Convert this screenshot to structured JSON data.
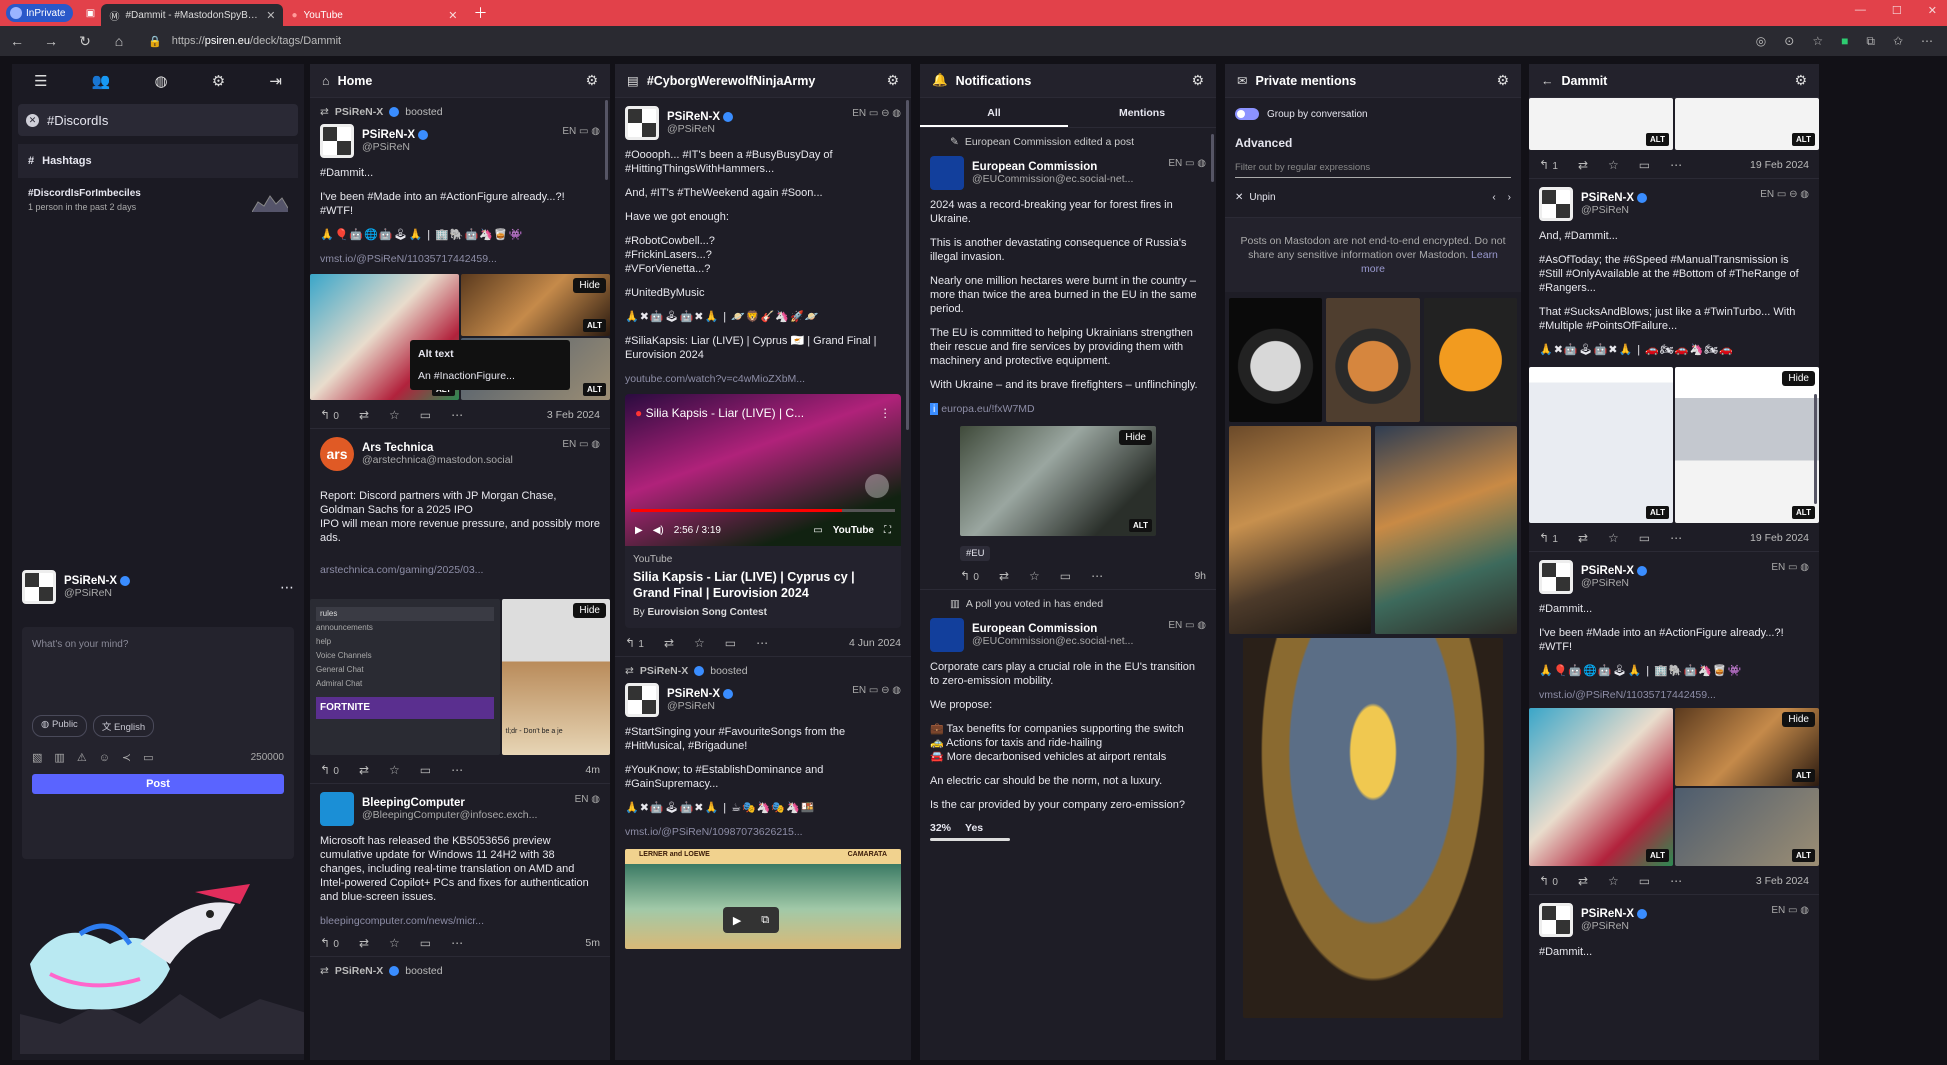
{
  "browser": {
    "inprivate": "InPrivate",
    "tabs": [
      {
        "title": "#Dammit - #MastodonSpyBalloon",
        "active": true
      },
      {
        "title": "YouTube",
        "active": false
      }
    ],
    "url_scheme": "https://",
    "url_host": "psiren.eu",
    "url_path": "/deck/tags/Dammit"
  },
  "nav": {
    "search_tag": "#DiscordIs",
    "hashtags_label": "Hashtags",
    "trend_tag": "#DiscordIsForImbeciles",
    "trend_stat": "1 person in the past 2 days",
    "me_name": "PSiReN-X",
    "me_acct": "@PSiReN",
    "compose_placeholder": "What's on your mind?",
    "visibility": "Public",
    "language": "English",
    "char_count": "250000",
    "post_label": "Post"
  },
  "home": {
    "title": "Home",
    "p1": {
      "boosted_by": "PSiReN-X",
      "boosted_label": "boosted",
      "name": "PSiReN-X",
      "acct": "@PSiReN",
      "lang": "EN",
      "l1": "#Dammit...",
      "l2": "I've been #Made into an #ActionFigure already...?! #WTF!",
      "emoji": "🙏🎈🤖🌐🤖🕹🙏 | 🏢🐘🤖🦄🥃👾",
      "link": "vmst.io/@PSiReN/11035717442459...",
      "alt_title": "Alt text",
      "alt_body": "An #InactionFigure...",
      "hide": "Hide",
      "alt": "ALT",
      "reply": "0",
      "date": "3 Feb 2024"
    },
    "p2": {
      "name": "Ars Technica",
      "acct": "@arstechnica@mastodon.social",
      "lang": "EN",
      "body": "Report: Discord partners with JP Morgan Chase, Goldman Sachs for a 2025 IPO\nIPO will mean more revenue pressure, and possibly more ads.",
      "link": "arstechnica.com/gaming/2025/03...",
      "reply": "0",
      "date": "4m",
      "shot_lines": [
        "rules",
        "announcements",
        "help",
        "Voice Channels",
        "General Chat",
        "Admiral Chat"
      ],
      "shot_banner": "FORTNITE",
      "shot_hint": "tl;dr - Don't be a je",
      "hide": "Hide"
    },
    "p3": {
      "name": "BleepingComputer",
      "acct": "@BleepingComputer@infosec.exch...",
      "lang": "EN",
      "body": "Microsoft has released the KB5053656 preview cumulative update for Windows 11 24H2 with 38 changes, including real-time translation on AMD and Intel-powered Copilot+ PCs and fixes for authentication and blue-screen issues.",
      "link": "bleepingcomputer.com/news/micr...",
      "reply": "0",
      "date": "5m"
    },
    "p4_boost": "PSiReN-X",
    "p4_boost_label": "boosted"
  },
  "cyborg": {
    "title": "#CyborgWerewolfNinjaArmy",
    "p1": {
      "name": "PSiReN-X",
      "acct": "@PSiReN",
      "lang": "EN",
      "b1": "#Ooooph... #IT's been a #BusyBusyDay of #HittingThingsWithHammers...",
      "b2": "And, #IT's #TheWeekend again #Soon...",
      "b3": "Have we got enough:",
      "b4": "#RobotCowbell...?\n#FrickinLasers...?\n#VForVienetta...?",
      "b5": "#UnitedByMusic",
      "emoji": "🙏✖🤖🕹🤖✖🙏 | 🪐🦁🎸🦄🚀🪐",
      "b6": "#SiliaKapsis: Liar (LIVE) | Cyprus 🇨🇾 | Grand Final | Eurovision 2024",
      "link": "youtube.com/watch?v=c4wMioZXbM...",
      "yt_title": "Silia Kapsis - Liar (LIVE) | C...",
      "yt_time": "2:56 / 3:19",
      "yt_brand": "YouTube",
      "yt_src": "YouTube",
      "yt_card_title": "Silia Kapsis - Liar (LIVE) | Cyprus cy | Grand Final | Eurovision 2024",
      "yt_by_label": "By",
      "yt_by": "Eurovision Song Contest",
      "reply": "1",
      "date": "4 Jun 2024"
    },
    "p2": {
      "boosted_by": "PSiReN-X",
      "boosted_label": "boosted",
      "name": "PSiReN-X",
      "acct": "@PSiReN",
      "lang": "EN",
      "b1": "#StartSinging your #FavouriteSongs from the #HitMusical, #Brigadune!",
      "b2": "#YouKnow; to #EstablishDominance and #GainSupremacy...",
      "emoji": "🙏✖🤖🕹🤖✖🙏 | ☕🎭🦄🎭🦄🍱",
      "link": "vmst.io/@PSiReN/10987073626215...",
      "poster_left": "LERNER and LOEWE",
      "poster_right": "CAMARATA"
    }
  },
  "notifications": {
    "title": "Notifications",
    "tab_all": "All",
    "tab_mentions": "Mentions",
    "n1_head": "European Commission edited a post",
    "n1": {
      "name": "European Commission",
      "acct": "@EUCommission@ec.social-net...",
      "lang": "EN",
      "b1": "2024 was a record-breaking year for forest fires in Ukraine.",
      "b2": "This is another devastating consequence of Russia's illegal invasion.",
      "b3": "Nearly one million hectares were burnt in the country – more than twice the area burned in the EU in the same period.",
      "b4": "The EU is committed to helping Ukrainians strengthen their rescue and fire services by providing them with machinery and protective equipment.",
      "b5": "With Ukraine – and its brave firefighters – unflinchingly.",
      "link": "europa.eu/!fxW7MD",
      "tag": "#EU",
      "hide": "Hide",
      "alt": "ALT",
      "reply": "0",
      "date": "9h"
    },
    "n2_head": "A poll you voted in has ended",
    "n2": {
      "name": "European Commission",
      "acct": "@EUCommission@ec.social-net...",
      "lang": "EN",
      "b1": "Corporate cars play a crucial role in the EU's transition to zero-emission mobility.",
      "b2": "We propose:",
      "b3": "💼 Tax benefits for companies supporting the switch\n🚕 Actions for taxis and ride-hailing\n🚘 More decarbonised vehicles at airport rentals",
      "b4": "An electric car should be the norm, not a luxury.",
      "b5": "Is the car provided by your company zero-emission?",
      "poll_pct": "32%",
      "poll_opt": "Yes",
      "poll_fraction": 0.32
    }
  },
  "mentions": {
    "title": "Private mentions",
    "group_label": "Group by conversation",
    "advanced": "Advanced",
    "filter_placeholder": "Filter out by regular expressions",
    "unpin": "Unpin",
    "e2e_text": "Posts on Mastodon are not end-to-end encrypted. Do not share any sensitive information over Mastodon.",
    "learn_more": "Learn more"
  },
  "dammit": {
    "title": "Dammit",
    "p0": {
      "reply": "1",
      "date": "19 Feb 2024",
      "alt": "ALT"
    },
    "p1": {
      "name": "PSiReN-X",
      "acct": "@PSiReN",
      "lang": "EN",
      "b1": "And, #Dammit...",
      "b2": "#AsOfToday; the #6Speed #ManualTransmission is #Still #OnlyAvailable at the #Bottom of #TheRange of #Rangers...",
      "b3": "That #SucksAndBlows; just like a #TwinTurbo... With #Multiple #PointsOfFailure...",
      "emoji": "🙏✖🤖🕹🤖✖🙏 | 🚗🏍🚗🦄🏍🚗",
      "hide": "Hide",
      "alt": "ALT",
      "reply": "1",
      "date": "19 Feb 2024"
    },
    "p2": {
      "name": "PSiReN-X",
      "acct": "@PSiReN",
      "lang": "EN",
      "b1": "#Dammit...",
      "b2": "I've been #Made into an #ActionFigure already...?! #WTF!",
      "emoji": "🙏🎈🤖🌐🤖🕹🙏 | 🏢🐘🤖🦄🥃👾",
      "link": "vmst.io/@PSiReN/11035717442459...",
      "hide": "Hide",
      "alt": "ALT",
      "reply": "0",
      "date": "3 Feb 2024"
    },
    "p3": {
      "name": "PSiReN-X",
      "acct": "@PSiReN",
      "lang": "EN",
      "b1": "#Dammit..."
    }
  }
}
